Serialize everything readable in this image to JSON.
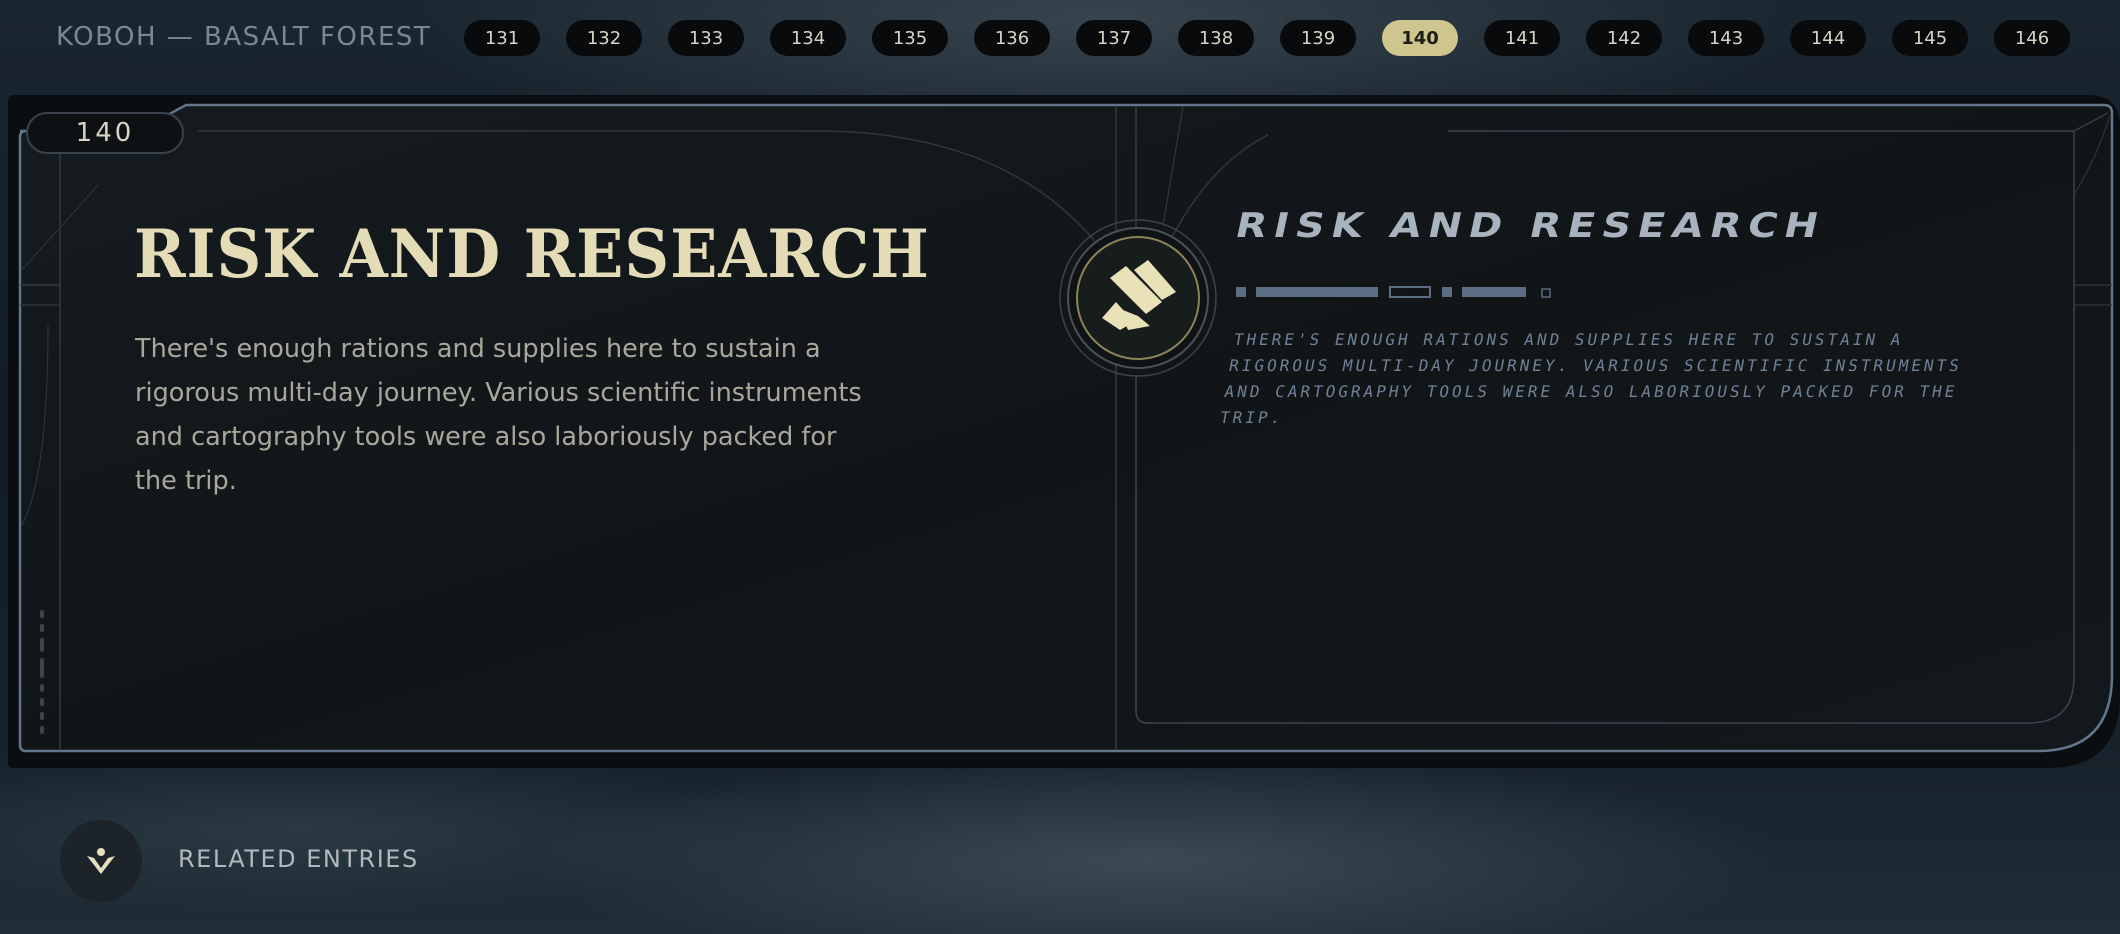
{
  "location": "KOBOH — BASALT FOREST",
  "entries": [
    "131",
    "132",
    "133",
    "134",
    "135",
    "136",
    "137",
    "138",
    "139",
    "140",
    "141",
    "142",
    "143",
    "144",
    "145",
    "146"
  ],
  "active_entry": "140",
  "panel": {
    "entry_number": "140",
    "title": "RISK AND RESEARCH",
    "body": "There's enough rations and supplies here to sustain a rigorous multi-day journey. Various scientific instruments and cartography tools were also laboriously packed for the trip.",
    "aurebesh_title": "RISK AND RESEARCH",
    "aurebesh_body": "There's enough rations and supplies here to sustain a rigorous multi-day journey. Various scientific instruments and cartography tools were also laboriously packed for the trip."
  },
  "emblem_icon": "databank-crate-icon",
  "related": {
    "label": "RELATED ENTRIES",
    "icon": "related-entries-icon"
  },
  "colors": {
    "accent": "#cfc58f",
    "title": "#e4dcb6",
    "frame": "#5b6b7c"
  }
}
